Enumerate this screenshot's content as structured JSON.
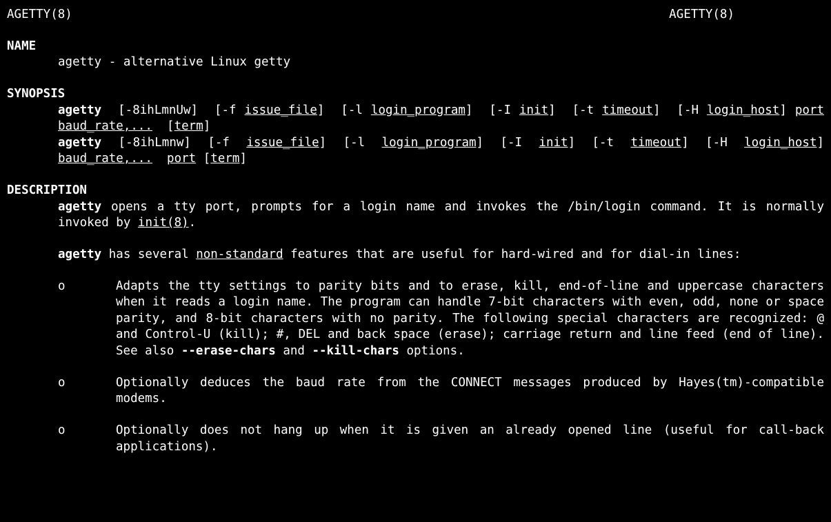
{
  "header": {
    "left": "AGETTY(8)",
    "right": "AGETTY(8)"
  },
  "sections": {
    "name": {
      "head": "NAME",
      "text": "agetty - alternative Linux getty"
    },
    "synopsis": {
      "head": "SYNOPSIS",
      "cmd": "agetty",
      "flags1": "[-8ihLmnUw]",
      "t_dashf": "[-f",
      "t_issue": "issue_file",
      "t_close": "]",
      "t_dashl": "[-l",
      "t_login": "login_program",
      "t_dashI": "[-I",
      "t_init": "init",
      "t_dasht": "[-t",
      "t_timeout": "timeout",
      "t_dashH": "[-H",
      "t_loginhost": "login_host",
      "t_port": "port",
      "t_baud": "baud_rate,...",
      "t_open": "[",
      "t_term": "term",
      "flags2": "[-8ihLmnw]",
      "t_dashf2": "[-f ",
      "t_dashl2": "[-l ",
      "t_dashI2": "[-I ",
      "t_dasht2": "[-t ",
      "t_dashH2": "[-H ",
      "t_close2": "] ",
      "t_closeSp": "]  "
    },
    "description": {
      "head": "DESCRIPTION",
      "p1_b1": "agetty",
      "p1_t1": " opens a tty port, prompts for a login name and invokes the /bin/login command. It is normally invoked by ",
      "p1_u1": "init(8)",
      "p1_t2": ".",
      "p2_b1": "agetty",
      "p2_t1": " has several ",
      "p2_u1": "non-standard",
      "p2_t2": " features that are useful for  hard-wired  and  for  dial-in lines:",
      "bullets": {
        "mark": "o",
        "b1_t1": "Adapts the tty settings to parity bits and to erase, kill, end-of-line and uppercase characters when it reads a login name.  The program can handle 7-bit characters with even,  odd, none or space parity, and 8-bit characters with no parity. The following special characters are recognized: @ and Control-U (kill); #,  DEL  and  back  space (erase);  carriage  return  and line feed (end of line).  See also ",
        "b1_bold1": "--erase-chars",
        "b1_t2": " and ",
        "b1_bold2": "--kill-chars",
        "b1_t3": " options.",
        "b2": "Optionally  deduces  the  baud  rate  from  the   CONNECT   messages   produced   by Hayes(tm)-compatible modems.",
        "b3": "Optionally  does  not  hang  up  when it is given an already opened line (useful for call-back applications)."
      }
    }
  }
}
